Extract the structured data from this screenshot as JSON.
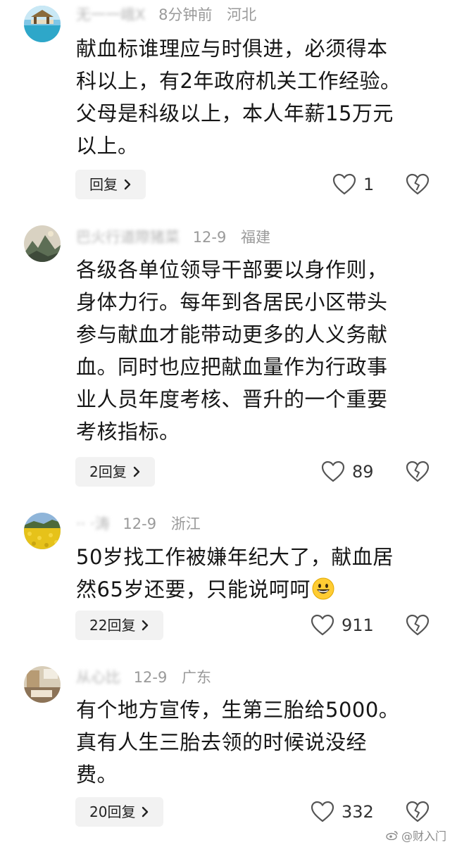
{
  "comments": [
    {
      "user": "无一一峨X",
      "time": "8分钟前",
      "location": "河北",
      "lines": [
        "献血标谁理应与时俱进，必须得本",
        "科以上，有2年政府机关工作经验。",
        "父母是科级以上，本人年薪15万元",
        "以上。"
      ],
      "reply_label": "回复",
      "likes": "1",
      "avatar_icon": "beach-avatar"
    },
    {
      "user": "巴火行道際猪菜",
      "time": "12-9",
      "location": "福建",
      "lines": [
        "各级各单位领导干部要以身作则，",
        "身体力行。每年到各居民小区带头",
        "参与献血才能带动更多的人义务献",
        "血。同时也应把献血量作为行政事",
        "业人员年度考核、晋升的一个重要",
        "考核指标。"
      ],
      "reply_label": "2回复",
      "likes": "89",
      "avatar_icon": "landscape-avatar"
    },
    {
      "user": "·· ·涛",
      "time": "12-9",
      "location": "浙江",
      "lines": [
        "50岁找工作被嫌年纪大了，献血居",
        "然65岁还要，只能说呵呵"
      ],
      "reply_label": "22回复",
      "likes": "911",
      "avatar_icon": "flower-field-avatar",
      "emoji": "grinning-face-emoji"
    },
    {
      "user": "从心比",
      "time": "12-9",
      "location": "广东",
      "lines": [
        "有个地方宣传，生第三胎给5000。",
        "真有人生三胎去领的时候说没经",
        "费。"
      ],
      "reply_label": "20回复",
      "likes": "332",
      "avatar_icon": "room-avatar"
    }
  ],
  "watermark": "@财入门",
  "colors": {
    "meta": "#9a9a9a",
    "text": "#161616",
    "reply_bg": "#f2f2f2",
    "icon": "#555555"
  }
}
